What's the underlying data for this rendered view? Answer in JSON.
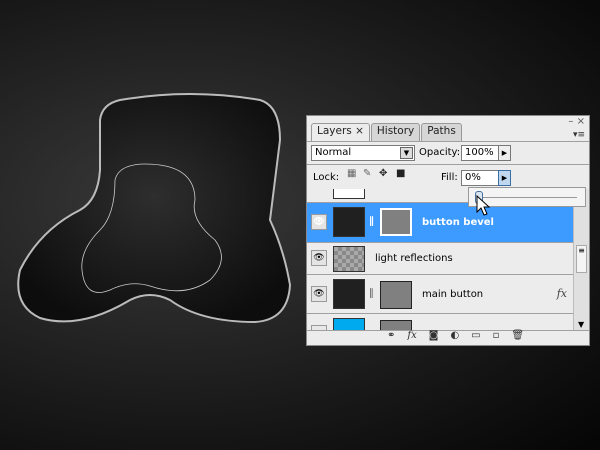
{
  "panel": {
    "tabs": [
      "Layers ×",
      "History",
      "Paths"
    ],
    "minimize": "–",
    "close": "×",
    "menu": "▾≡",
    "blend_mode": "Normal",
    "opacity_label": "Opacity:",
    "opacity": "100%",
    "lock_label": "Lock:",
    "fill_label": "Fill:",
    "fill": "0%",
    "fill_slider_fraction": 0,
    "layers": [
      {
        "name": "button bevel",
        "selected": true,
        "visible": true,
        "fx": false
      },
      {
        "name": "light reflections",
        "selected": false,
        "visible": true,
        "fx": false
      },
      {
        "name": "main button",
        "selected": false,
        "visible": true,
        "fx": true
      },
      {
        "name": "",
        "selected": false,
        "visible": false,
        "fx": true
      }
    ],
    "fx_label": "fx"
  },
  "colors": {
    "selection": "#3d9bff",
    "partial_layer": "#00aaee"
  }
}
